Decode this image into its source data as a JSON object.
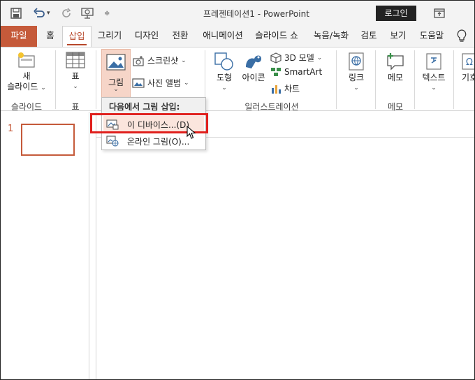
{
  "titlebar": {
    "title": "프레젠테이션1  -  PowerPoint",
    "login_label": "로그인"
  },
  "tabs": [
    {
      "label": "파일"
    },
    {
      "label": "홈"
    },
    {
      "label": "삽입"
    },
    {
      "label": "그리기"
    },
    {
      "label": "디자인"
    },
    {
      "label": "전환"
    },
    {
      "label": "애니메이션"
    },
    {
      "label": "슬라이드 쇼"
    },
    {
      "label": "녹음/녹화"
    },
    {
      "label": "검토"
    },
    {
      "label": "보기"
    },
    {
      "label": "도움말"
    }
  ],
  "ribbon": {
    "new_slide_line1": "새",
    "new_slide_line2": "슬라이드",
    "group_slide": "슬라이드",
    "table_label": "표",
    "group_table": "표",
    "picture_label": "그림",
    "screenshot_label": "스크린샷",
    "photo_album_label": "사진 앨범",
    "shapes_label": "도형",
    "icons_label": "아이콘",
    "model3d_label": "3D 모델",
    "smartart_label": "SmartArt",
    "chart_label": "차트",
    "group_illustrations": "일러스트레이션",
    "link_label": "링크",
    "comment_label": "메모",
    "group_comment": "메모",
    "text_label": "텍스트",
    "symbols_label": "기호"
  },
  "dropdown": {
    "header": "다음에서 그림 삽입:",
    "items": [
      {
        "label": "이 디바이스...(D)"
      },
      {
        "label": "온라인 그림(O)..."
      }
    ]
  },
  "slides": [
    {
      "number": "1"
    }
  ],
  "colors": {
    "accent": "#c55a3a",
    "highlight_border": "#e0201d"
  }
}
